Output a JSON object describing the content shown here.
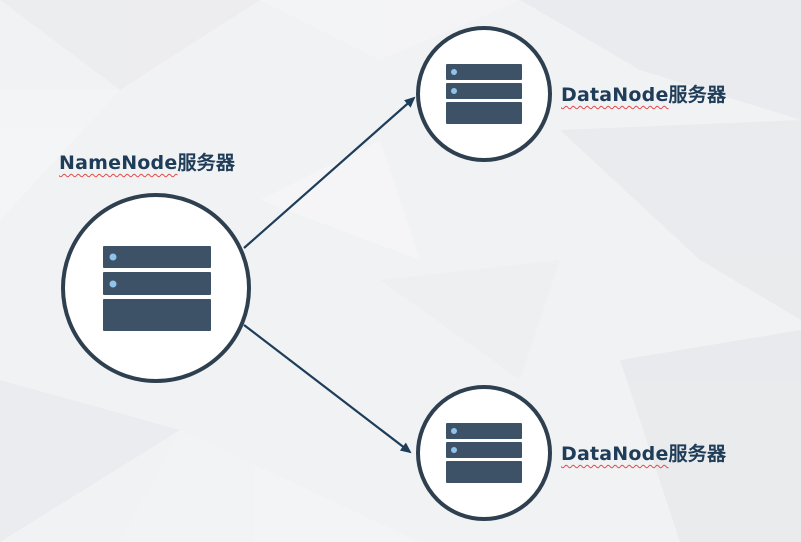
{
  "nodes": {
    "namenode": {
      "name": "NameNode",
      "suffix": "服务器",
      "icon": "server-rack-icon"
    },
    "datanode_top": {
      "name": "DataNode",
      "suffix": "服务器",
      "icon": "server-rack-icon"
    },
    "datanode_bottom": {
      "name": "DataNode",
      "suffix": "服务器",
      "icon": "server-rack-icon"
    }
  },
  "edges": [
    {
      "from": "namenode",
      "to": "datanode_top"
    },
    {
      "from": "namenode",
      "to": "datanode_bottom"
    }
  ],
  "colors": {
    "background": "#f1f2f4",
    "circle_stroke": "#2e3f4f",
    "server_fill": "#3e5267",
    "server_led": "#8fc3ec",
    "arrow": "#1d3d58",
    "label": "#1f3c58"
  }
}
